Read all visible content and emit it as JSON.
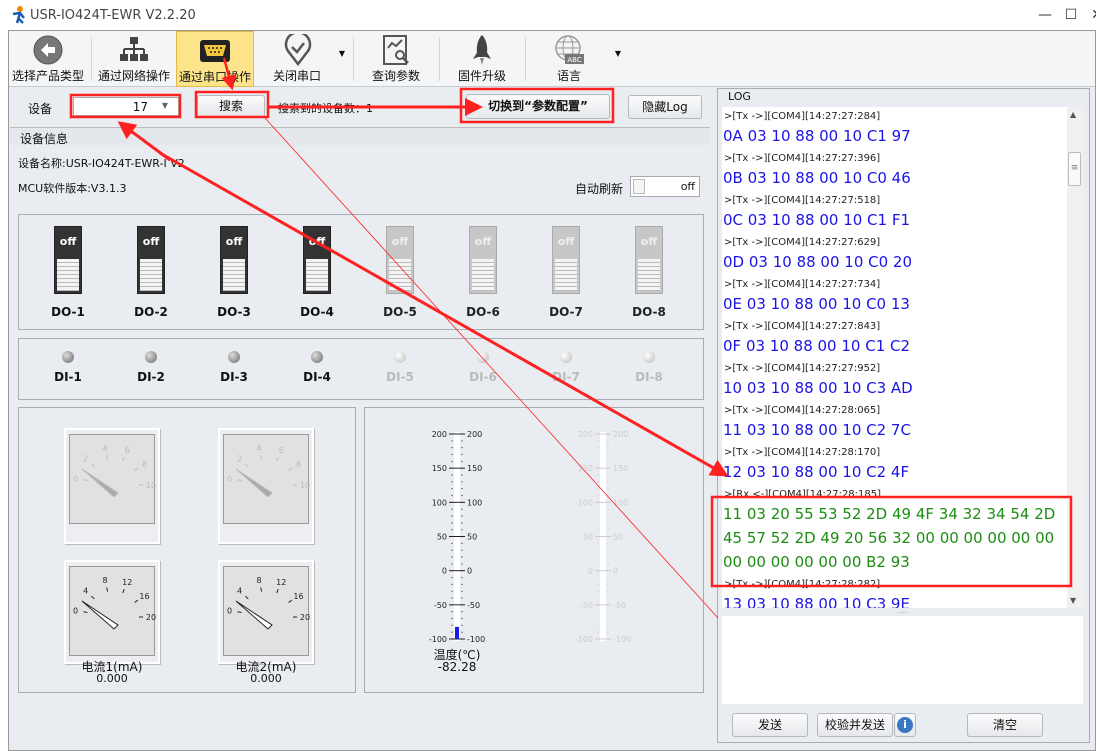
{
  "window": {
    "title": "USR-IO424T-EWR V2.2.20",
    "minimize": "—",
    "maximize": "☐",
    "close": "✕"
  },
  "toolbar": [
    {
      "label": "选择产品类型",
      "icon": "back-arrow-icon"
    },
    {
      "label": "通过网络操作",
      "icon": "network-icon"
    },
    {
      "label": "通过串口操作",
      "icon": "serial-port-icon",
      "selected": true
    },
    {
      "label": "关闭串口",
      "icon": "location-check-icon",
      "dropdown": true
    },
    {
      "label": "查询参数",
      "icon": "query-chart-icon"
    },
    {
      "label": "固件升级",
      "icon": "rocket-icon"
    },
    {
      "label": "语言",
      "icon": "globe-abc-icon",
      "dropdown": true
    }
  ],
  "device_bar": {
    "device_label": "设备",
    "device_value": "17",
    "search": "搜索",
    "found_label": "搜索到的设备数：1",
    "switch_btn": "切换到“参数配置”",
    "hide_log": "隐藏Log"
  },
  "device_info": {
    "header": "设备信息",
    "name": "设备名称:USR-IO424T-EWR-I V2",
    "mcu": "MCU软件版本:V3.1.3",
    "auto_refresh_label": "自动刷新",
    "auto_refresh_state": "off"
  },
  "do": [
    {
      "label": "DO-1",
      "state": "off",
      "enabled": true
    },
    {
      "label": "DO-2",
      "state": "off",
      "enabled": true
    },
    {
      "label": "DO-3",
      "state": "off",
      "enabled": true
    },
    {
      "label": "DO-4",
      "state": "off",
      "enabled": true
    },
    {
      "label": "DO-5",
      "state": "off",
      "enabled": false
    },
    {
      "label": "DO-6",
      "state": "off",
      "enabled": false
    },
    {
      "label": "DO-7",
      "state": "off",
      "enabled": false
    },
    {
      "label": "DO-8",
      "state": "off",
      "enabled": false
    }
  ],
  "di": [
    {
      "label": "DI-1",
      "enabled": true
    },
    {
      "label": "DI-2",
      "enabled": true
    },
    {
      "label": "DI-3",
      "enabled": true
    },
    {
      "label": "DI-4",
      "enabled": true
    },
    {
      "label": "DI-5",
      "enabled": false
    },
    {
      "label": "DI-6",
      "enabled": false
    },
    {
      "label": "DI-7",
      "enabled": false
    },
    {
      "label": "DI-8",
      "enabled": false
    }
  ],
  "gauges": {
    "disabled_ticks": [
      "0",
      "2",
      "4",
      "6",
      "8",
      "10"
    ],
    "ticks": [
      "0",
      "4",
      "8",
      "12",
      "16",
      "20"
    ],
    "items": [
      {
        "label": "电流1(mA)",
        "value": "0.000"
      },
      {
        "label": "电流2(mA)",
        "value": "0.000"
      }
    ]
  },
  "thermo": {
    "ticks": [
      "200",
      "150",
      "100",
      "50",
      "0",
      "-50",
      "-100"
    ],
    "label": "温度(℃)",
    "value": "-82.28",
    "reading": -82.28,
    "min": -100,
    "max": 200
  },
  "log": {
    "header": "LOG",
    "entries": [
      {
        "head": ">[Tx ->][COM4][14:27:27:284]",
        "data": [
          "0A 03 10 88 00 10 C1 97"
        ]
      },
      {
        "head": ">[Tx ->][COM4][14:27:27:396]",
        "data": [
          "0B 03 10 88 00 10 C0 46"
        ]
      },
      {
        "head": ">[Tx ->][COM4][14:27:27:518]",
        "data": [
          "0C 03 10 88 00 10 C1 F1"
        ]
      },
      {
        "head": ">[Tx ->][COM4][14:27:27:629]",
        "data": [
          "0D 03 10 88 00 10 C0 20"
        ]
      },
      {
        "head": ">[Tx ->][COM4][14:27:27:734]",
        "data": [
          "0E 03 10 88 00 10 C0 13"
        ]
      },
      {
        "head": ">[Tx ->][COM4][14:27:27:843]",
        "data": [
          "0F 03 10 88 00 10 C1 C2"
        ]
      },
      {
        "head": ">[Tx ->][COM4][14:27:27:952]",
        "data": [
          "10 03 10 88 00 10 C3 AD"
        ]
      },
      {
        "head": ">[Tx ->][COM4][14:27:28:065]",
        "data": [
          "11 03 10 88 00 10 C2 7C"
        ]
      },
      {
        "head": ">[Tx ->][COM4][14:27:28:170]",
        "data": [
          "12 03 10 88 00 10 C2 4F"
        ]
      },
      {
        "head": ">[Rx <-][COM4][14:27:28:185]",
        "rx": true,
        "data": [
          "11 03 20 55 53 52 2D 49 4F 34 32 34 54 2D",
          "45 57 52 2D 49 20 56 32 00 00 00 00 00 00",
          "00 00 00 00 00 00 B2 93"
        ]
      },
      {
        "head": ">[Tx ->][COM4][14:27:28:282]",
        "data": [
          "13 03 10 88 00 10 C3 9E"
        ]
      }
    ],
    "send": "发送",
    "verify_send": "校验并发送",
    "clear": "清空",
    "splitter": "....",
    "info_icon": "i"
  },
  "colors": {
    "selected_tool": "#fde48a",
    "tx": "#1a14e6",
    "rx": "#1b8d12",
    "annotation": "#ff2020"
  }
}
